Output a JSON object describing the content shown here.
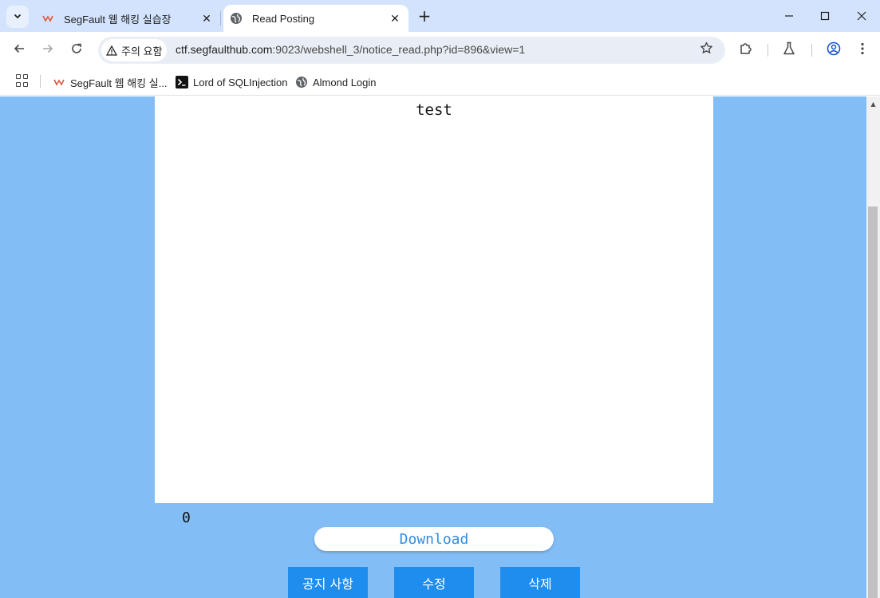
{
  "browser": {
    "tabs": [
      {
        "title": "SegFault 웹 해킹 실습장",
        "active": false
      },
      {
        "title": "Read Posting",
        "active": true
      }
    ],
    "new_tab_label": "+",
    "security_chip": "주의 요함",
    "url_host": "ctf.segfaulthub.com",
    "url_rest": ":9023/webshell_3/notice_read.php?id=896&view=1",
    "bookmarks": [
      {
        "label": "SegFault 웹 해킹 실..."
      },
      {
        "label": "Lord of SQLInjection"
      },
      {
        "label": "Almond Login"
      }
    ]
  },
  "page": {
    "post_content": "test",
    "count": "0",
    "download_label": "Download",
    "buttons": {
      "notice": "공지 사항",
      "edit": "수정",
      "delete": "삭제"
    }
  },
  "colors": {
    "page_background": "#83bdf5",
    "button_blue": "#1f8ded",
    "download_text": "#2f8de4",
    "tabstrip": "#d3e3fd"
  }
}
